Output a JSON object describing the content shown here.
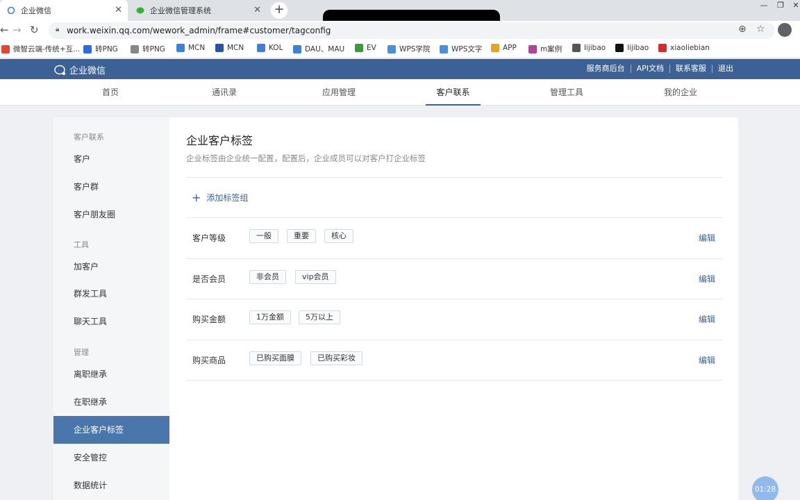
{
  "browser": {
    "tabs": [
      {
        "title": "企业微信",
        "active": true
      },
      {
        "title": "企业微信管理系统",
        "active": false
      }
    ],
    "url": "work.weixin.qq.com/wework_admin/frame#customer/tagconfig",
    "bookmarks": [
      {
        "label": "微智云端-传统+互...",
        "color": "#e4462f"
      },
      {
        "label": "转PNG",
        "color": "#2d6be4"
      },
      {
        "label": "转PNG",
        "color": "#888888"
      },
      {
        "label": "MCN",
        "color": "#3d7fd9"
      },
      {
        "label": "MCN",
        "color": "#2456a6"
      },
      {
        "label": "KOL",
        "color": "#3d7fd9"
      },
      {
        "label": "DAU、MAU",
        "color": "#3d7fd9"
      },
      {
        "label": "EV",
        "color": "#3a9b3a"
      },
      {
        "label": "WPS学院",
        "color": "#4a8fe0"
      },
      {
        "label": "WPS文字",
        "color": "#4a8fe0"
      },
      {
        "label": "APP",
        "color": "#e8a323"
      },
      {
        "label": "m案例",
        "color": "#b3429a"
      },
      {
        "label": "lijibao",
        "color": "#555555"
      },
      {
        "label": "lijibao",
        "color": "#111111"
      },
      {
        "label": "xiaoliebian",
        "color": "#d42c2c"
      }
    ]
  },
  "app": {
    "logo": "企业微信",
    "header_links": [
      "服务商后台",
      "API文档",
      "联系客服",
      "退出"
    ],
    "nav": [
      "首页",
      "通讯录",
      "应用管理",
      "客户联系",
      "管理工具",
      "我的企业"
    ],
    "active_nav": 3
  },
  "sidebar": {
    "groups": [
      {
        "label": "客户联系",
        "items": [
          "客户",
          "客户群",
          "客户朋友圈"
        ]
      },
      {
        "label": "工具",
        "items": [
          "加客户",
          "群发工具",
          "聊天工具"
        ]
      },
      {
        "label": "管理",
        "items": [
          "离职继承",
          "在职继承",
          "企业客户标签",
          "安全管控",
          "数据统计"
        ]
      }
    ],
    "active_item": "企业客户标签"
  },
  "content": {
    "title": "企业客户标签",
    "subtitle": "企业标签由企业统一配置，配置后，企业成员可以对客户打企业标签",
    "add_group_label": "添加标签组",
    "edit_label": "编辑",
    "tag_groups": [
      {
        "name": "客户等级",
        "tags": [
          "一般",
          "重要",
          "核心"
        ]
      },
      {
        "name": "是否会员",
        "tags": [
          "非会员",
          "vip会员"
        ]
      },
      {
        "name": "购买金额",
        "tags": [
          "1万金额",
          "5万以上"
        ]
      },
      {
        "name": "购买商品",
        "tags": [
          "已购买面膜",
          "已购买彩妆"
        ]
      }
    ]
  },
  "overlay": {
    "timer": "01:28"
  }
}
